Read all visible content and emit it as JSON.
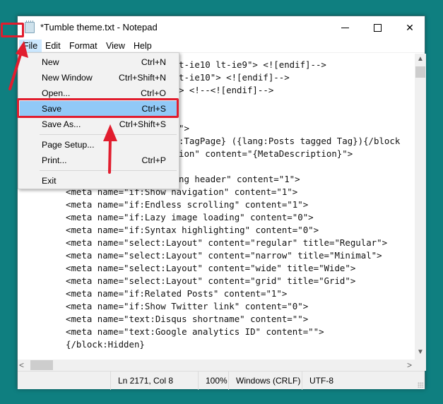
{
  "window": {
    "title": "*Tumble theme.txt - Notepad",
    "icon": "notepad-icon",
    "controls": {
      "minimize": "minimize-icon",
      "maximize": "maximize-icon",
      "close": "close-icon",
      "close_glyph": "✕"
    }
  },
  "menubar": {
    "items": [
      {
        "label": "File"
      },
      {
        "label": "Edit"
      },
      {
        "label": "Format"
      },
      {
        "label": "View"
      },
      {
        "label": "Help"
      }
    ]
  },
  "file_menu": {
    "items": [
      {
        "label": "New",
        "shortcut": "Ctrl+N"
      },
      {
        "label": "New Window",
        "shortcut": "Ctrl+Shift+N"
      },
      {
        "label": "Open...",
        "shortcut": "Ctrl+O"
      },
      {
        "label": "Save",
        "shortcut": "Ctrl+S",
        "highlighted": true
      },
      {
        "label": "Save As...",
        "shortcut": "Ctrl+Shift+S"
      },
      {
        "label": "Page Setup...",
        "shortcut": ""
      },
      {
        "label": "Print...",
        "shortcut": "Ctrl+P"
      },
      {
        "label": "Exit",
        "shortcut": ""
      }
    ]
  },
  "editor": {
    "lines": [
      "t-ie10 lt-ie9\"> <![endif]-->",
      "t-ie10\"> <![endif]-->",
      "> <!--<![endif]-->",
      "\">",
      ":TagPage} ({lang:Posts tagged Tag}){/block",
      "ion\" content=\"{MetaDescription}\">",
      "ng header\" content=\"1\">",
      "<meta name=\"if:Show navigation\" content=\"1\">",
      "<meta name=\"if:Endless scrolling\" content=\"1\">",
      "<meta name=\"if:Lazy image loading\" content=\"0\">",
      "<meta name=\"if:Syntax highlighting\" content=\"0\">",
      "<meta name=\"select:Layout\" content=\"regular\" title=\"Regular\">",
      "<meta name=\"select:Layout\" content=\"narrow\" title=\"Minimal\">",
      "<meta name=\"select:Layout\" content=\"wide\" title=\"Wide\">",
      "<meta name=\"select:Layout\" content=\"grid\" title=\"Grid\">",
      "<meta name=\"if:Related Posts\" content=\"1\">",
      "<meta name=\"if:Show Twitter link\" content=\"0\">",
      "<meta name=\"text:Disqus shortname\" content=\"\">",
      "<meta name=\"text:Google analytics ID\" content=\"\">",
      "{/block:Hidden}"
    ]
  },
  "scrollbars": {
    "up": "▲",
    "down": "▼",
    "left": "<",
    "right": ">"
  },
  "statusbar": {
    "position": "Ln 2171, Col 8",
    "zoom": "100%",
    "line_ending": "Windows (CRLF)",
    "encoding": "UTF-8"
  },
  "annotations": {
    "color": "#e11d2e",
    "highlighted_menu": "File",
    "highlighted_item": "Save"
  }
}
